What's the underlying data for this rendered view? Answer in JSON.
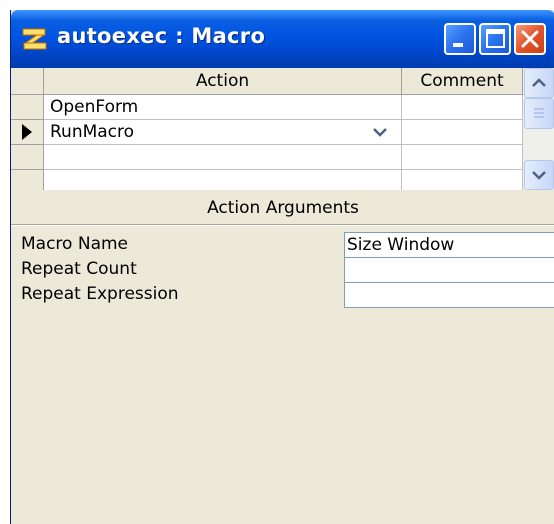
{
  "window": {
    "title": "autoexec : Macro"
  },
  "grid": {
    "columns": [
      "Action",
      "Comment"
    ],
    "rows": [
      {
        "action": "OpenForm",
        "comment": ""
      },
      {
        "action": "RunMacro",
        "comment": "",
        "current": true
      },
      {
        "action": "",
        "comment": ""
      }
    ]
  },
  "arguments": {
    "header": "Action Arguments",
    "fields": [
      {
        "label": "Macro Name",
        "value": "Size Window"
      },
      {
        "label": "Repeat Count",
        "value": ""
      },
      {
        "label": "Repeat Expression",
        "value": ""
      }
    ]
  },
  "colors": {
    "titlebar": "#0054e3",
    "close_button": "#e2542a",
    "window_face": "#ece9d8",
    "field_border": "#7f9db9"
  },
  "icons": [
    "macro-icon",
    "minimize-icon",
    "maximize-icon",
    "close-icon",
    "record-pointer-icon",
    "dropdown-arrow-icon",
    "scroll-up-icon",
    "scroll-down-icon"
  ]
}
